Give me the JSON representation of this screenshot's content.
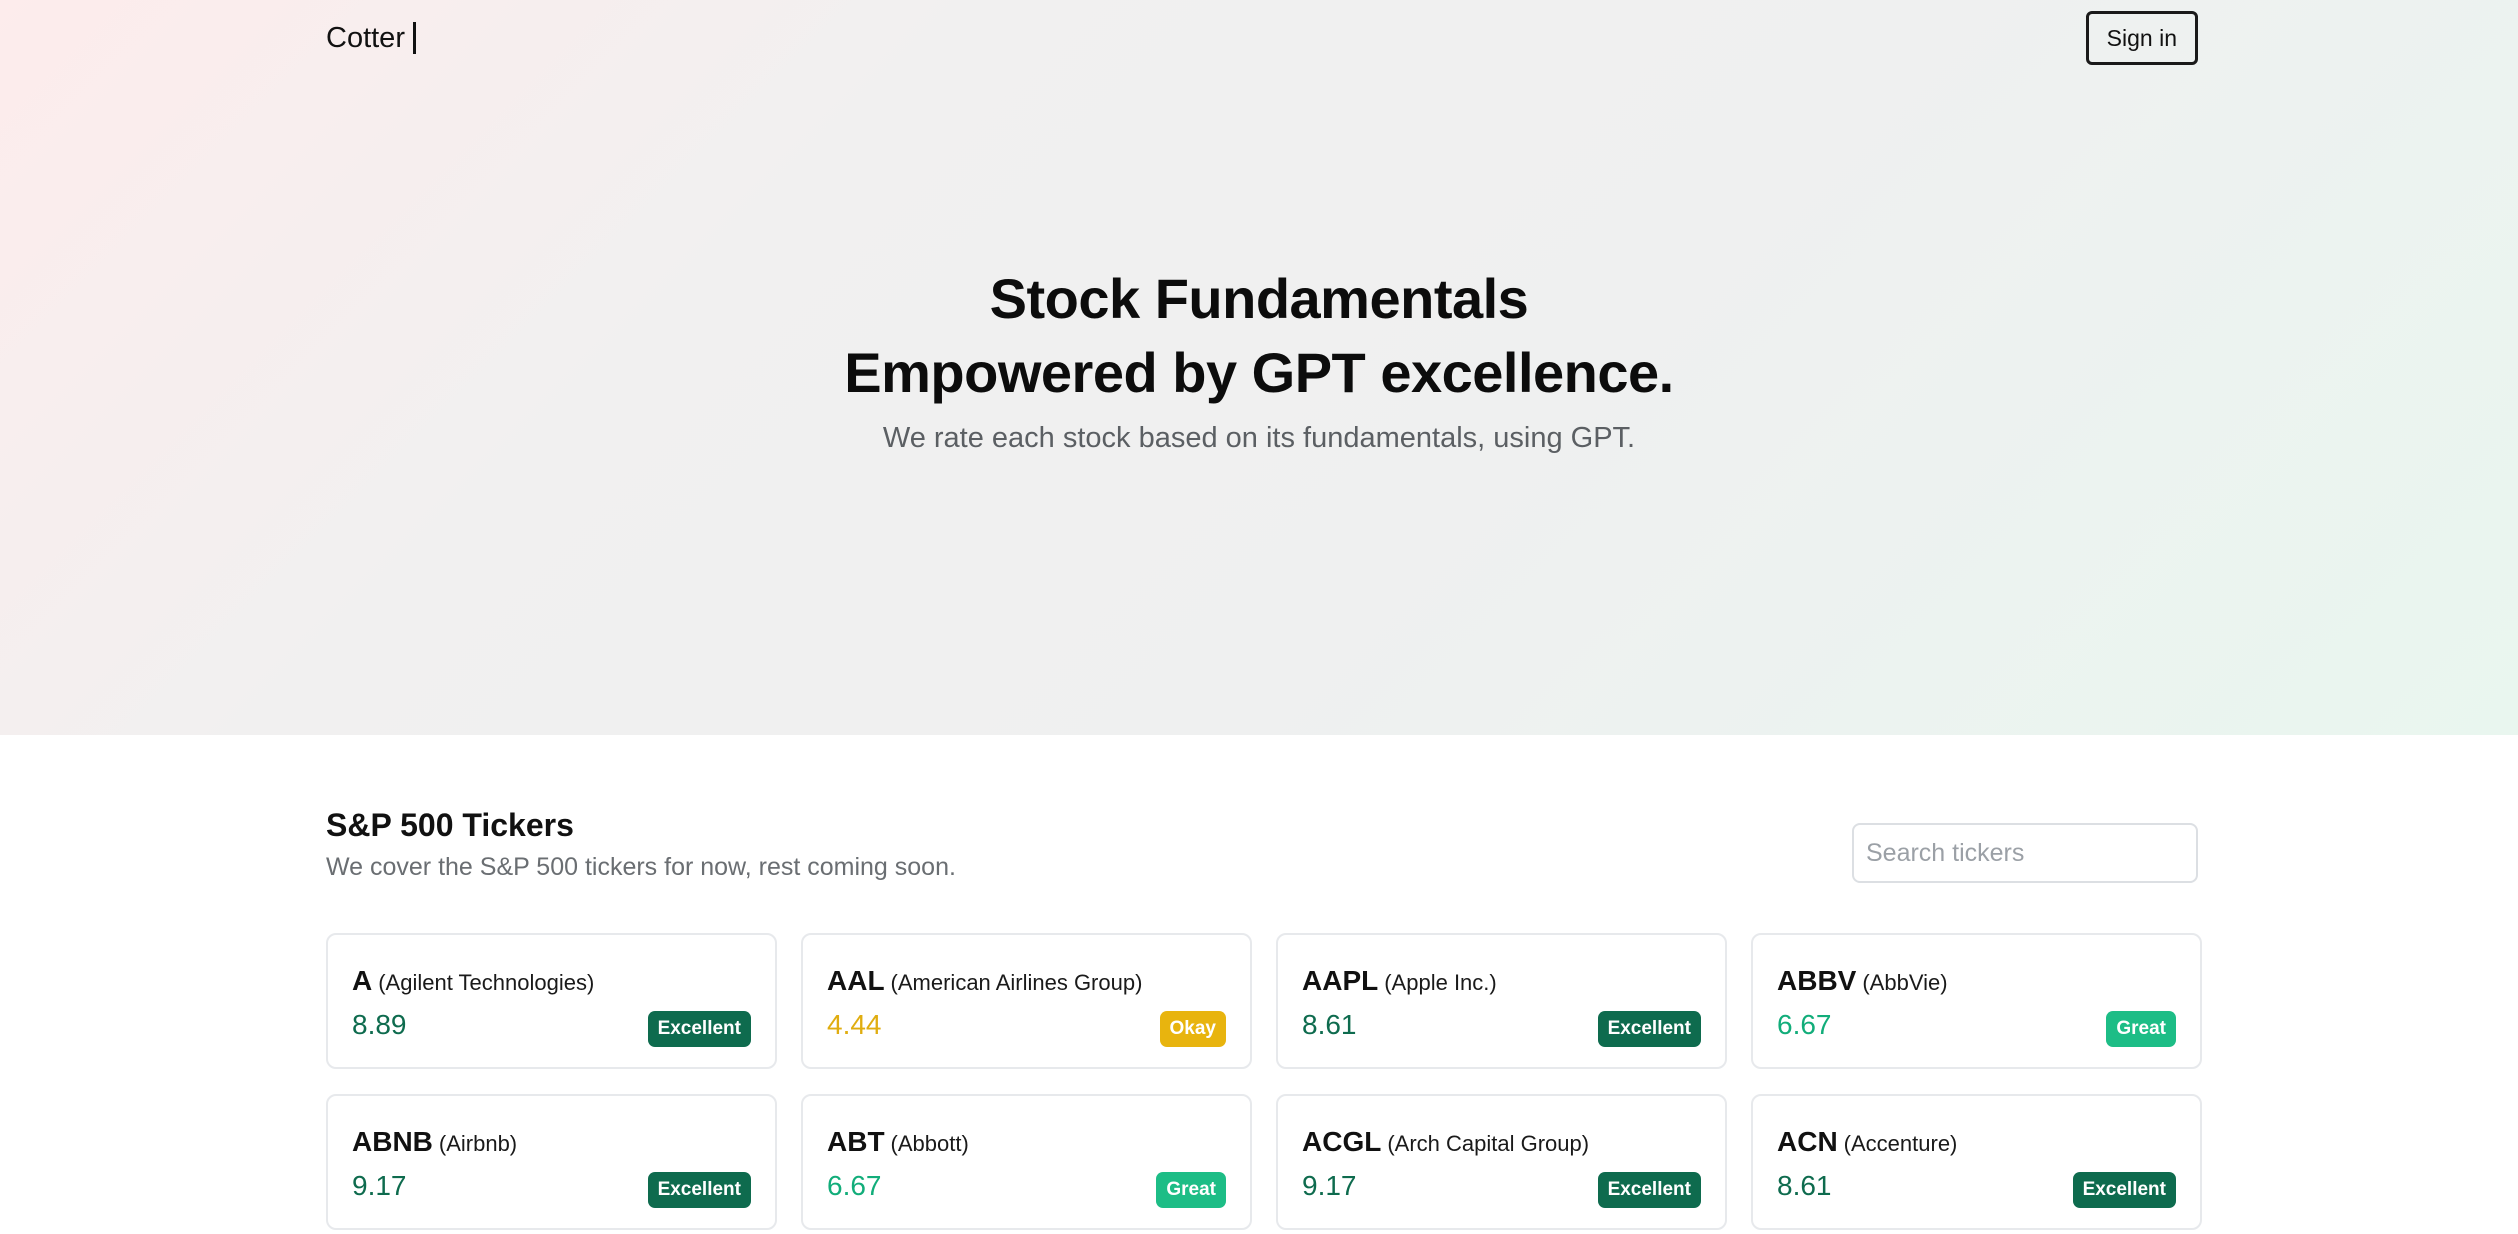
{
  "header": {
    "brand": "Cotter",
    "sign_in_label": "Sign in"
  },
  "hero": {
    "headline_line1": "Stock Fundamentals",
    "headline_line2": "Empowered by GPT excellence.",
    "subtitle": "We rate each stock based on its fundamentals, using GPT."
  },
  "tickers_section": {
    "title": "S&P 500 Tickers",
    "description": "We cover the S&P 500 tickers for now, rest coming soon.",
    "search_placeholder": "Search tickers",
    "search_value": ""
  },
  "colors": {
    "excellent": "#0e6b4e",
    "great": "#1dbd86",
    "okay": "#e8b40e"
  },
  "cards": [
    {
      "ticker": "A",
      "company": "(Agilent Technologies)",
      "score": "8.89",
      "rating": "Excellent",
      "tone": "excellent"
    },
    {
      "ticker": "AAL",
      "company": "(American Airlines Group)",
      "score": "4.44",
      "rating": "Okay",
      "tone": "okay"
    },
    {
      "ticker": "AAPL",
      "company": "(Apple Inc.)",
      "score": "8.61",
      "rating": "Excellent",
      "tone": "excellent"
    },
    {
      "ticker": "ABBV",
      "company": "(AbbVie)",
      "score": "6.67",
      "rating": "Great",
      "tone": "great"
    },
    {
      "ticker": "ABNB",
      "company": "(Airbnb)",
      "score": "9.17",
      "rating": "Excellent",
      "tone": "excellent"
    },
    {
      "ticker": "ABT",
      "company": "(Abbott)",
      "score": "6.67",
      "rating": "Great",
      "tone": "great"
    },
    {
      "ticker": "ACGL",
      "company": "(Arch Capital Group)",
      "score": "9.17",
      "rating": "Excellent",
      "tone": "excellent"
    },
    {
      "ticker": "ACN",
      "company": "(Accenture)",
      "score": "8.61",
      "rating": "Excellent",
      "tone": "excellent"
    }
  ]
}
